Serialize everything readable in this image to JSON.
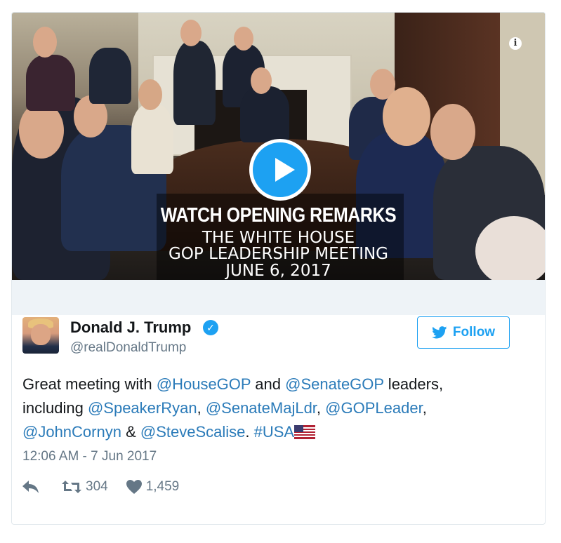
{
  "media": {
    "title_line1": "WATCH OPENING REMARKS",
    "title_line2": "THE WHITE HOUSE",
    "title_line3": "GOP LEADERSHIP MEETING",
    "title_line4": "JUNE 6, 2017",
    "play_icon": "play-icon",
    "info_icon": "info-icon"
  },
  "author": {
    "name": "Donald J. Trump",
    "handle": "@realDonaldTrump",
    "verified_icon": "verified-badge-icon"
  },
  "follow": {
    "label": "Follow",
    "icon": "twitter-bird-icon"
  },
  "tweet": {
    "t1": "Great meeting with ",
    "m1": "@HouseGOP",
    "t2": " and ",
    "m2": "@SenateGOP",
    "t3": " leaders, including ",
    "m3": "@SpeakerRyan",
    "t4": ", ",
    "m4": "@SenateMajLdr",
    "t5": ", ",
    "m5": "@GOPLeader",
    "t6": ", ",
    "m6": "@JohnCornyn",
    "t7": " & ",
    "m7": "@SteveScalise",
    "t8": ". ",
    "m8": "#USA",
    "flag_icon": "us-flag-icon"
  },
  "timestamp": "12:06 AM - 7 Jun 2017",
  "actions": {
    "reply_icon": "reply-icon",
    "retweet_icon": "retweet-icon",
    "retweet_count": "304",
    "like_icon": "heart-icon",
    "like_count": "1,459"
  },
  "colors": {
    "accent": "#1da1f2",
    "link": "#2b7bb9",
    "muted": "#657786"
  }
}
